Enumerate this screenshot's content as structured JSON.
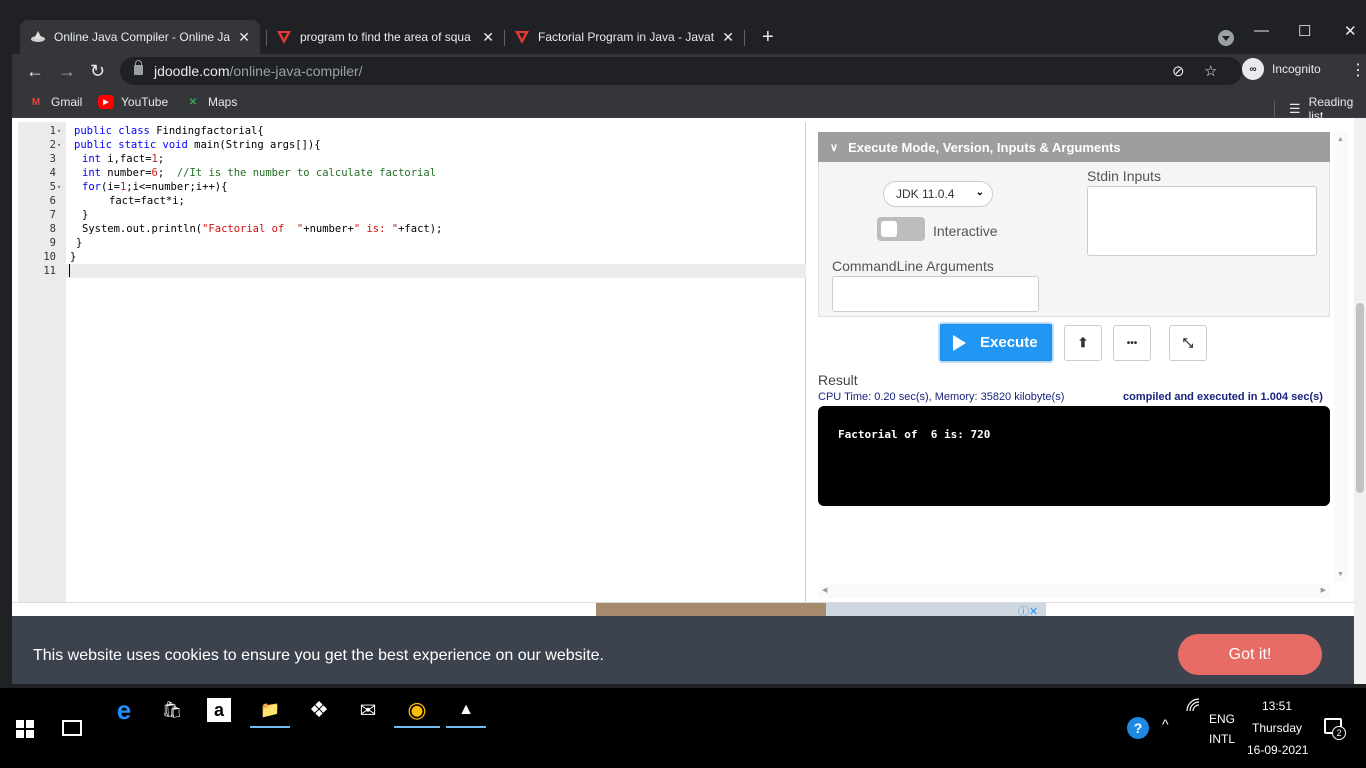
{
  "browser": {
    "tabs": [
      {
        "title": "Online Java Compiler - Online Jav",
        "active": true
      },
      {
        "title": "program to find the area of squa",
        "active": false
      },
      {
        "title": "Factorial Program in Java - Javatp",
        "active": false
      }
    ],
    "tab_close": "✕",
    "new_tab": "+",
    "window": {
      "minimize": "—",
      "maximize": "☐",
      "close": "✕"
    },
    "nav": {
      "back": "←",
      "forward": "→",
      "reload": "↻"
    },
    "url": {
      "host": "jdoodle.com",
      "path": "/online-java-compiler/"
    },
    "omni_icons": {
      "eye_off": "⊘",
      "star": "☆"
    },
    "incognito_label": "Incognito",
    "incognito_badge": "∞",
    "menu": "⋮",
    "bookmarks": [
      {
        "label": "Gmail",
        "icon": "M"
      },
      {
        "label": "YouTube",
        "icon": "▶"
      },
      {
        "label": "Maps",
        "icon": "✕"
      }
    ],
    "reading_list": "Reading list",
    "reading_list_icon": "☰"
  },
  "editor": {
    "line_numbers": [
      "1",
      "2",
      "3",
      "4",
      "5",
      "6",
      "7",
      "8",
      "9",
      "10",
      "11"
    ],
    "fold_marker": "▾",
    "lines": {
      "l1": {
        "kw1": "public",
        "kw2": "class",
        "rest": " Findingfactorial{"
      },
      "l2": {
        "kw1": "public",
        "kw2": "static",
        "kw3": "void",
        "rest": " main(String args[]){"
      },
      "l3": {
        "kw": "int",
        "a": " i,fact=",
        "n": "1",
        "b": ";"
      },
      "l4": {
        "kw": "int",
        "a": " number=",
        "n": "6",
        "b": ";  ",
        "comment": "//It is the number to calculate factorial"
      },
      "l5": {
        "kw": "for",
        "a": "(i=",
        "n": "1",
        "b": ";i<=number;i++){"
      },
      "l6": {
        "text": "fact=fact*i;"
      },
      "l7": {
        "text": "}"
      },
      "l8": {
        "a": "System.out.println(",
        "s1": "\"Factorial of  \"",
        "b": "+number+",
        "s2": "\" is: \"",
        "c": "+fact);"
      },
      "l9": {
        "text": "}"
      },
      "l10": {
        "text": "}"
      },
      "l11": {
        "text": ""
      }
    }
  },
  "settings": {
    "header": "Execute Mode, Version, Inputs & Arguments",
    "chevron": "∨",
    "jdk_version": "JDK 11.0.4",
    "jdk_caret": "⌄",
    "interactive_label": "Interactive",
    "stdin_label": "Stdin Inputs",
    "cmd_label": "CommandLine Arguments"
  },
  "actions": {
    "execute_label": "Execute",
    "upload_icon": "⬆",
    "more_icon": "•••",
    "collapse_icon": "⤡"
  },
  "result": {
    "label": "Result",
    "cpu": "CPU Time: 0.20 sec(s), Memory: 35820 kilobyte(s)",
    "compiled": "compiled and executed in 1.004 sec(s)",
    "output": "Factorial of  6 is: 720"
  },
  "scroll_arrows": {
    "up": "▲",
    "down": "▼",
    "left": "◀",
    "right": "▶"
  },
  "ad": {
    "close": "ⓘ✕"
  },
  "cookie": {
    "message": "This website uses cookies to ensure you get the best experience on our website.",
    "button": "Got it!"
  },
  "taskbar": {
    "apps": [
      "e",
      "🛍",
      "a",
      "📁",
      "❖",
      "✉",
      "◉",
      "▲"
    ],
    "help": "?",
    "chevron_up": "^",
    "lang_top": "ENG",
    "lang_bottom": "INTL",
    "time": "13:51",
    "day": "Thursday",
    "date": "16-09-2021",
    "notification_count": "2"
  },
  "colors": {
    "chrome_dark": "#202124",
    "chrome_bar": "#35363a",
    "execute_blue": "#2196f3",
    "cookie_bg": "#3c434e",
    "cookie_button": "#e86c66",
    "accordion_header": "#9e9e9e"
  }
}
